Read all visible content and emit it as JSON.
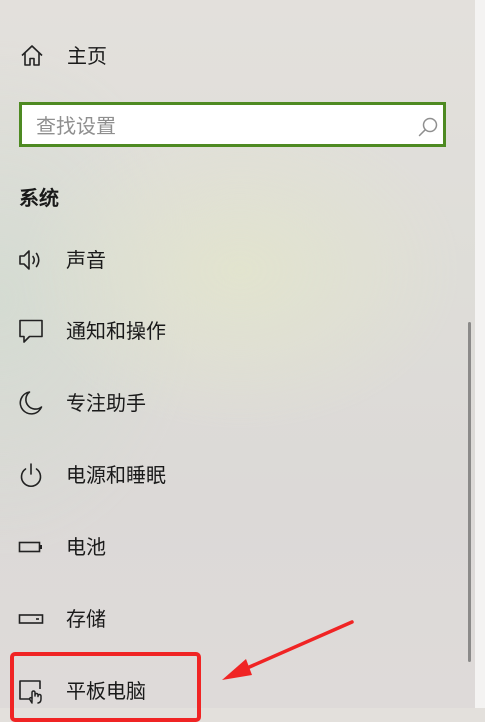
{
  "home": {
    "label": "主页",
    "icon": "home-icon"
  },
  "search": {
    "placeholder": "查找设置",
    "value": "",
    "icon": "search-icon",
    "border_color": "#4e8a22"
  },
  "section": {
    "title": "系统"
  },
  "nav": {
    "items": [
      {
        "label": "声音",
        "icon": "speaker-icon"
      },
      {
        "label": "通知和操作",
        "icon": "notification-icon"
      },
      {
        "label": "专注助手",
        "icon": "moon-icon"
      },
      {
        "label": "电源和睡眠",
        "icon": "power-icon"
      },
      {
        "label": "电池",
        "icon": "battery-icon"
      },
      {
        "label": "存储",
        "icon": "storage-icon"
      },
      {
        "label": "平板电脑",
        "icon": "tablet-icon"
      }
    ]
  },
  "annotation": {
    "color": "#f02424",
    "highlighted_item": "平板电脑"
  }
}
